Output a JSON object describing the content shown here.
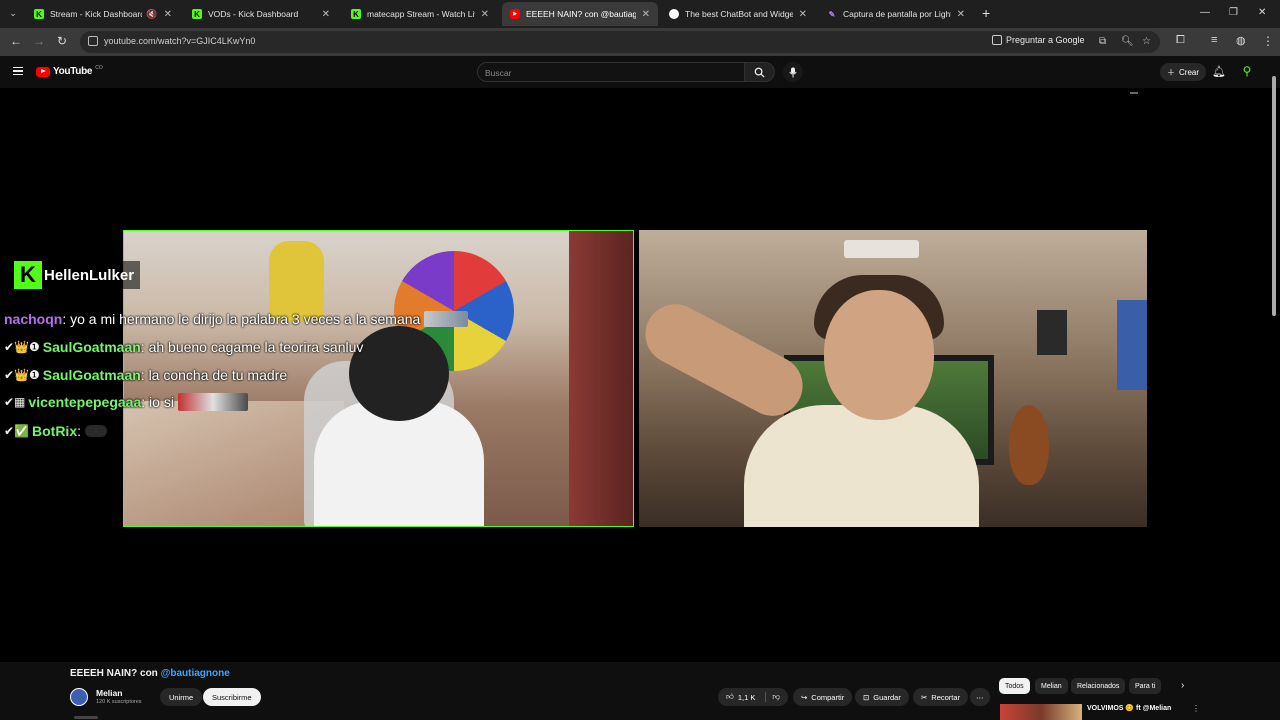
{
  "browser": {
    "tabs": [
      {
        "title": "Stream - Kick Dashboard",
        "favicon": "kick-icon",
        "muted": true,
        "active": false
      },
      {
        "title": "VODs - Kick Dashboard",
        "favicon": "kick-icon",
        "active": false
      },
      {
        "title": "matecapp Stream - Watch Live",
        "favicon": "kick-icon",
        "active": false
      },
      {
        "title": "EEEEH NAIN? con @bautiagnone",
        "favicon": "youtube-icon",
        "active": true
      },
      {
        "title": "The best ChatBot and Widgets",
        "favicon": "bot-icon",
        "active": false
      },
      {
        "title": "Captura de pantalla por Lightshot",
        "favicon": "pen-icon",
        "active": false
      }
    ],
    "new_tab": "+",
    "url": "youtube.com/watch?v=GJIC4LKwYn0",
    "ask_google": "Preguntar a Google"
  },
  "youtube": {
    "logo_text": "YouTube",
    "logo_sup": "CO",
    "search_placeholder": "Buscar",
    "create_label": "Crear"
  },
  "overlay": {
    "highlight_user": "HellenLulker",
    "chat": [
      {
        "user": "nachoqn",
        "color": "#b86cf0",
        "badges": "",
        "message": ": yo a mi hermano le dirijo la palabra 3 veces a la semana"
      },
      {
        "user": "SaulGoatmaan",
        "color": "#74f56a",
        "badges": "✔👑❶",
        "message": ": ah bueno cagame la teorira sanluv"
      },
      {
        "user": "SaulGoatmaan",
        "color": "#74f56a",
        "badges": "✔👑❶",
        "message": ": la concha de tu madre"
      },
      {
        "user": "vicentepepegaaa",
        "color": "#74f56a",
        "badges": "✔▦",
        "message": ": io si"
      },
      {
        "user": "BotRix",
        "color": "#74f56a",
        "badges": "✔✅",
        "message": ":"
      }
    ]
  },
  "video": {
    "title": "EEEEH NAIN? con",
    "title_mention": "@bautiagnone",
    "channel_name": "Melian",
    "subscribers": "120 K suscriptores",
    "join_label": "Unirme",
    "subscribe_label": "Suscribirme",
    "likes": "1,1 K",
    "share_label": "Compartir",
    "save_label": "Guardar",
    "clip_label": "Recortar",
    "more_label": "⋯"
  },
  "sidebar": {
    "chips": [
      "Todos",
      "Melian",
      "Relacionados",
      "Para ti"
    ],
    "recommendation_title": "VOLVIMOS 😊 ft @Melian"
  }
}
